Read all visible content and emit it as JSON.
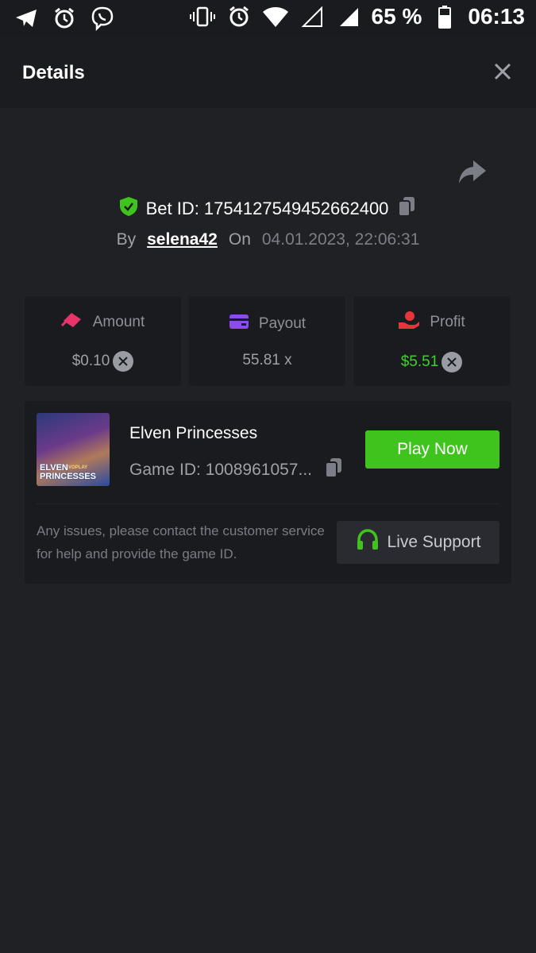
{
  "status_bar": {
    "battery": "65 %",
    "time": "06:13",
    "left_icons": [
      "telegram-icon",
      "alarm-icon",
      "viber-icon"
    ],
    "right_icons": [
      "vibrate-icon",
      "alarm-icon",
      "wifi-icon",
      "signal-icon"
    ]
  },
  "header": {
    "title": "Details"
  },
  "bet": {
    "id_label": "Bet ID: 1754127549452662400",
    "by_label": "By",
    "username": "selena42",
    "on_label": "On",
    "datetime": "04.01.2023, 22:06:31"
  },
  "stats": [
    {
      "label": "Amount",
      "value": "$0.10",
      "icon": "amount-icon",
      "color": "#e8346b"
    },
    {
      "label": "Payout",
      "value": "55.81 x",
      "icon": "wallet-icon",
      "color": "#8a4cf0"
    },
    {
      "label": "Profit",
      "value": "$5.51",
      "icon": "profit-icon",
      "color": "#e8343b"
    }
  ],
  "game": {
    "name": "Elven Princesses",
    "id_label": "Game ID: 1008961057...",
    "thumb_text": "ELVEN PRINCESSES",
    "thumb_brand": "EVOPLAY",
    "play_label": "Play Now"
  },
  "support": {
    "help_text": "Any issues, please contact the customer service for help and provide the game ID.",
    "button_label": "Live Support"
  },
  "colors": {
    "accent_green": "#3fc41d",
    "profit_green": "#3fd02b",
    "background": "#202125"
  }
}
